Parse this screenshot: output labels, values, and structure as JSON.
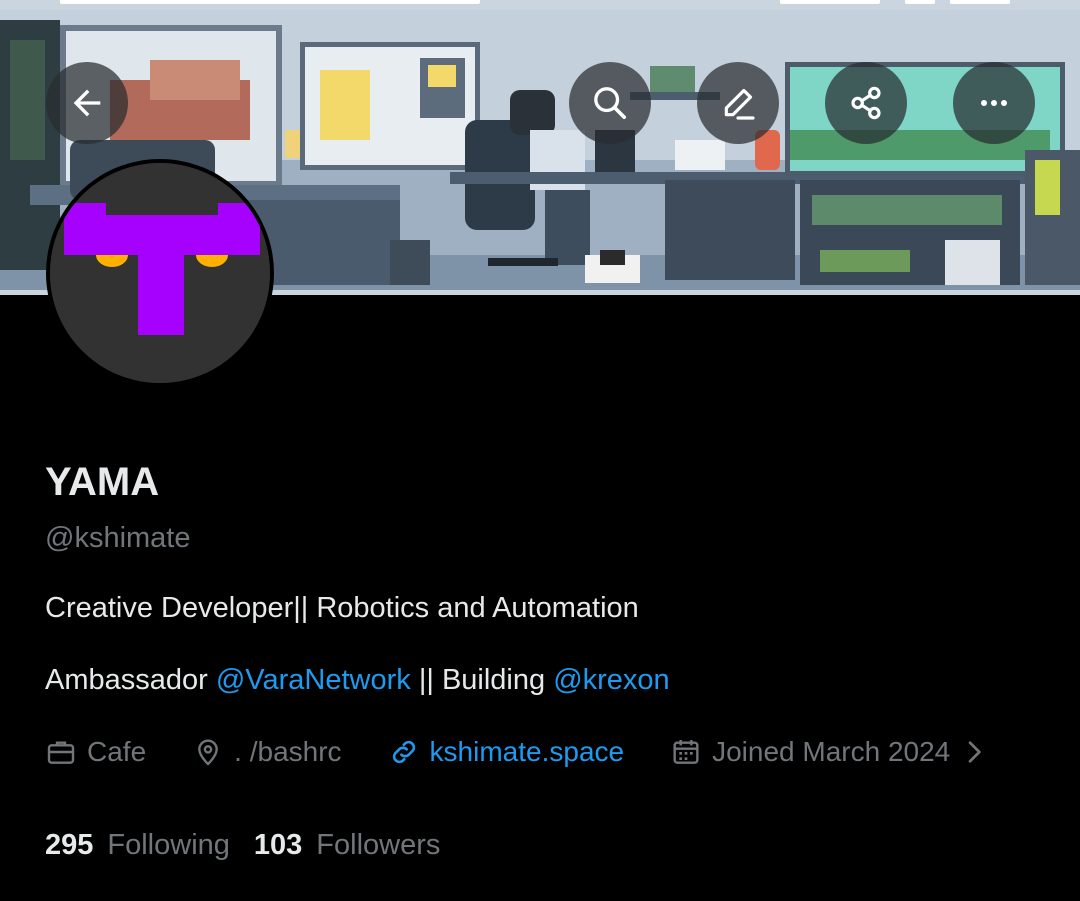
{
  "header": {
    "back_icon": "arrow-left-icon",
    "search_icon": "search-icon",
    "edit_icon": "pencil-icon",
    "share_icon": "share-icon",
    "more_icon": "more-horizontal-icon"
  },
  "profile": {
    "display_name": "YAMA",
    "handle": "@kshimate",
    "bio_line1": "Creative Developer|| Robotics and Automation",
    "bio_line2_prefix": "Ambassador ",
    "bio_line2_mention1": "@VaraNetwork",
    "bio_line2_middle": " || Building ",
    "bio_line2_mention2": "@krexon",
    "avatar_colors": {
      "background": "#323232",
      "shape": "#a600ff",
      "eyes": "#ffb000"
    }
  },
  "meta": {
    "work_icon": "briefcase-icon",
    "work": "Cafe",
    "location_icon": "map-pin-icon",
    "location": ". /bashrc",
    "link_icon": "link-icon",
    "website": "kshimate.space",
    "joined_icon": "calendar-icon",
    "joined": "Joined March 2024",
    "chevron_icon": "chevron-right-icon"
  },
  "stats": {
    "following_count": "295",
    "following_label": "Following",
    "followers_count": "103",
    "followers_label": "Followers"
  },
  "colors": {
    "accent": "#1d9bf0",
    "secondary_text": "#71767b",
    "primary_text": "#e7e9ea",
    "background": "#000000"
  }
}
